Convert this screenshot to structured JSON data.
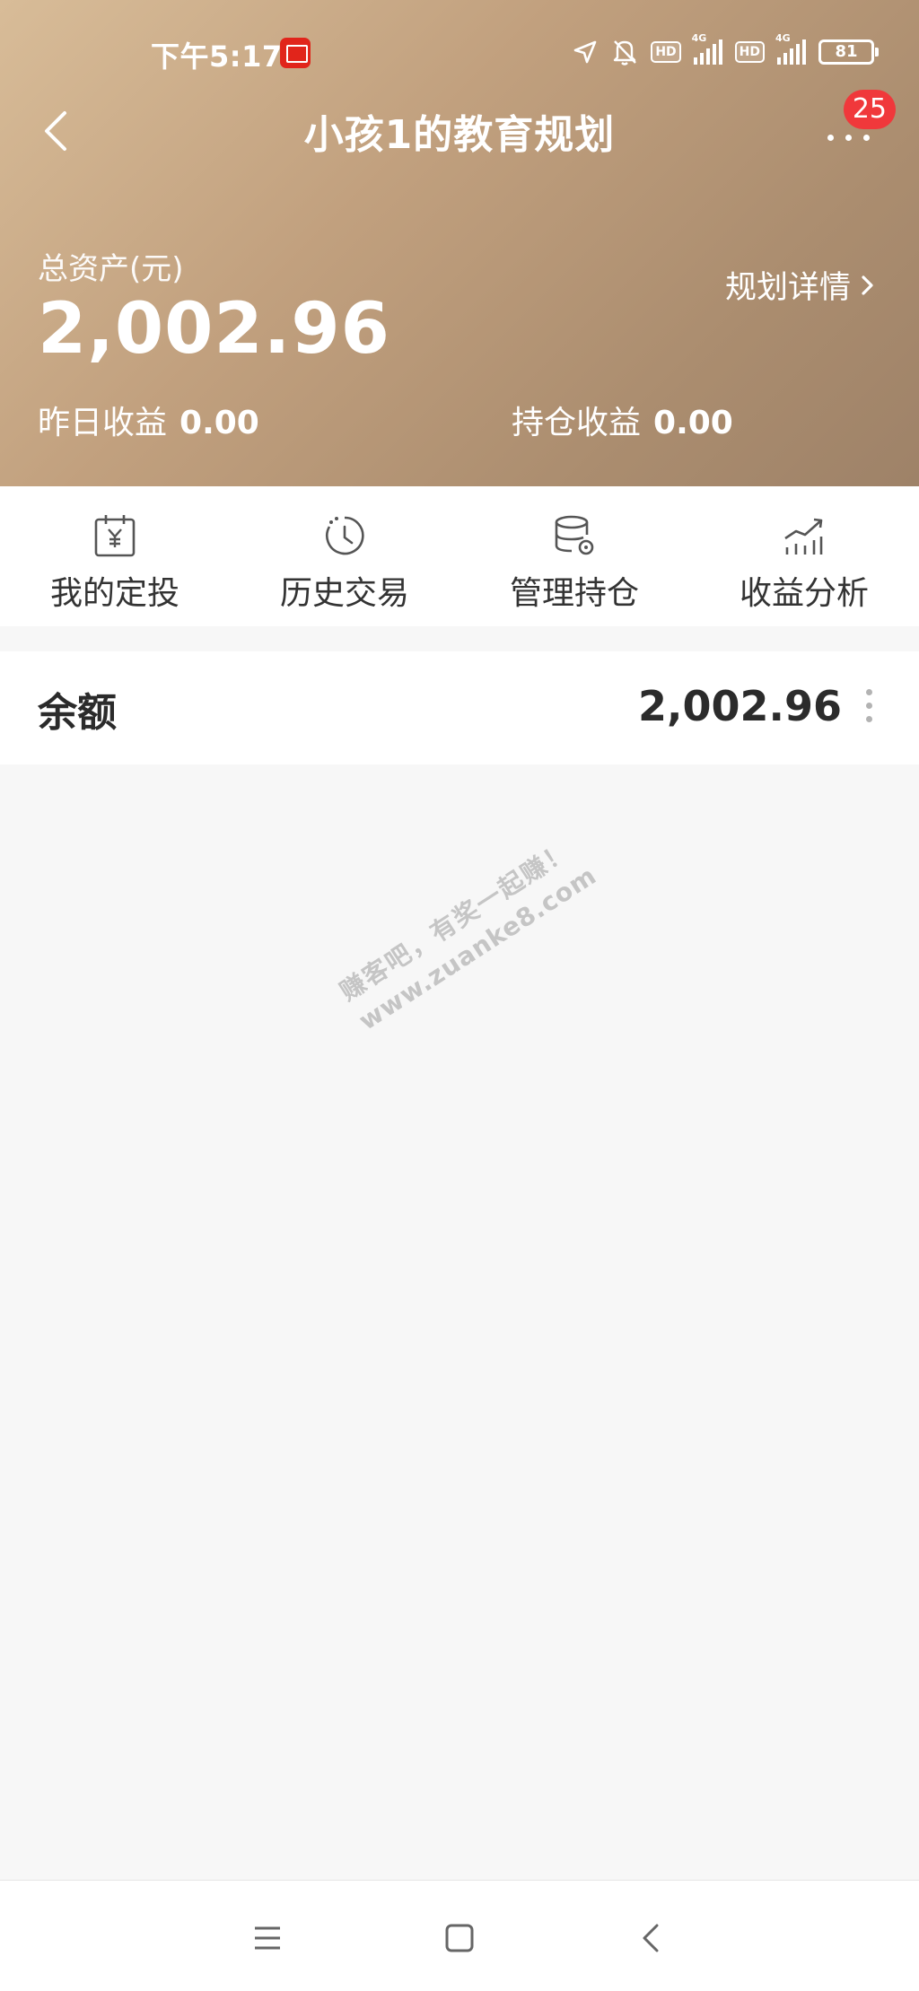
{
  "status_bar": {
    "time": "下午5:17",
    "hd_label": "HD",
    "network_label": "4G",
    "battery": "81"
  },
  "nav": {
    "title": "小孩1的教育规划",
    "badge_count": "25"
  },
  "summary": {
    "asset_label": "总资产(元)",
    "asset_value": "2,002.96",
    "plan_detail_label": "规划详情",
    "yesterday_label": "昨日收益",
    "yesterday_value": "0.00",
    "holding_label": "持仓收益",
    "holding_value": "0.00"
  },
  "actions": [
    {
      "label": "我的定投",
      "icon": "calendar-yen-icon"
    },
    {
      "label": "历史交易",
      "icon": "history-clock-icon"
    },
    {
      "label": "管理持仓",
      "icon": "database-gear-icon"
    },
    {
      "label": "收益分析",
      "icon": "trend-chart-icon"
    }
  ],
  "balance": {
    "label": "余额",
    "value": "2,002.96"
  },
  "watermark": {
    "line1": "赚客吧，有奖一起赚！",
    "line2": "www.zuanke8.com"
  },
  "colors": {
    "header_gradient_start": "#d8bc98",
    "header_gradient_end": "#9e8268",
    "badge_red": "#f0383b",
    "page_bg": "#f7f7f7"
  }
}
